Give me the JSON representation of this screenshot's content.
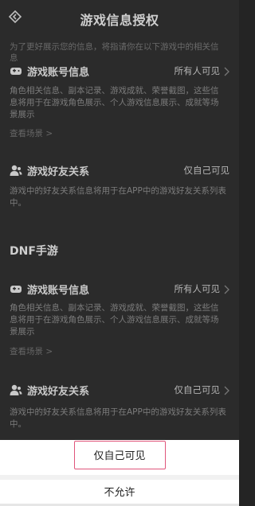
{
  "header": {
    "title": "游戏信息授权"
  },
  "intro": "为了更好展示您的信息，将指请你在以下游戏中的相关信息",
  "section1": {
    "account": {
      "label": "游戏账号信息",
      "value": "所有人可见"
    },
    "account_desc": "角色相关信息、副本记录、游戏成就、荣誉截图，这些信息将用于在游戏角色展示、个人游戏信息展示、成就等场景展示",
    "account_scene": "查看场景 >",
    "friends": {
      "label": "游戏好友关系",
      "value": "仅自己可见"
    },
    "friends_desc": "游戏中的好友关系信息将用于在APP中的游戏好友关系列表中。"
  },
  "game2": {
    "title": "DNF手游",
    "account": {
      "label": "游戏账号信息",
      "value": "所有人可见"
    },
    "account_desc": "角色相关信息、副本记录、游戏成就、荣誉截图，这些信息将用于在游戏角色展示、个人游戏信息展示、成就等场景展示",
    "account_scene": "查看场景 >",
    "friends": {
      "label": "游戏好友关系",
      "value": "仅自己可见"
    },
    "friends_desc": "游戏中的好友关系信息将用于在APP中的游戏好友关系列表中。"
  },
  "sheet": {
    "option_self": "仅自己可见",
    "option_deny": "不允许"
  },
  "colors": {
    "highlight": "#e0557b",
    "overlay": "#2b2b2b",
    "sheet": "#ffffff"
  }
}
